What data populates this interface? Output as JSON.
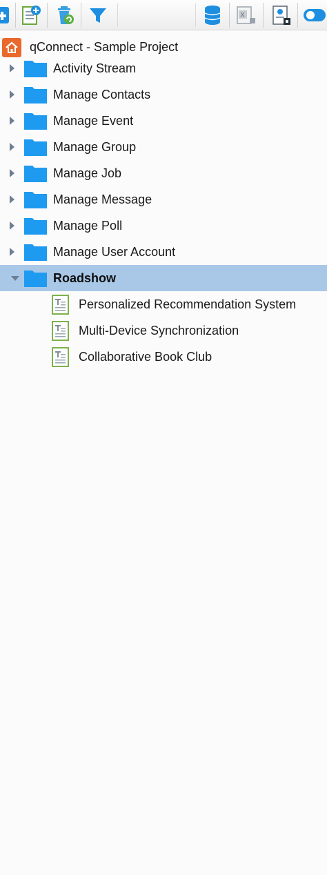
{
  "toolbar": {
    "buttons": [
      {
        "name": "new-item-button",
        "icon": "add-square-icon"
      },
      {
        "name": "add-document-button",
        "icon": "document-add-icon"
      },
      {
        "name": "delete-button",
        "icon": "trash-icon"
      },
      {
        "name": "filter-button",
        "icon": "filter-icon"
      },
      {
        "name": "database-button",
        "icon": "database-icon"
      },
      {
        "name": "excel-export-button",
        "icon": "excel-icon"
      },
      {
        "name": "report-button",
        "icon": "report-icon"
      },
      {
        "name": "toggle-button",
        "icon": "toggle-icon"
      }
    ]
  },
  "tree": {
    "root_label": "qConnect - Sample Project",
    "folders": [
      {
        "label": "Activity Stream",
        "expanded": false
      },
      {
        "label": "Manage Contacts",
        "expanded": false
      },
      {
        "label": "Manage Event",
        "expanded": false
      },
      {
        "label": "Manage Group",
        "expanded": false
      },
      {
        "label": "Manage Job",
        "expanded": false
      },
      {
        "label": "Manage Message",
        "expanded": false
      },
      {
        "label": "Manage Poll",
        "expanded": false
      },
      {
        "label": "Manage User Account",
        "expanded": false
      },
      {
        "label": "Roadshow",
        "expanded": true,
        "selected": true
      }
    ],
    "roadshow_children": [
      {
        "label": "Personalized Recommendation System"
      },
      {
        "label": "Multi-Device Synchronization"
      },
      {
        "label": "Collaborative Book Club"
      }
    ]
  },
  "colors": {
    "folder": "#1e9bf0",
    "selection": "#a9c8e7",
    "home": "#e9692c",
    "doc_border": "#7db24a"
  }
}
